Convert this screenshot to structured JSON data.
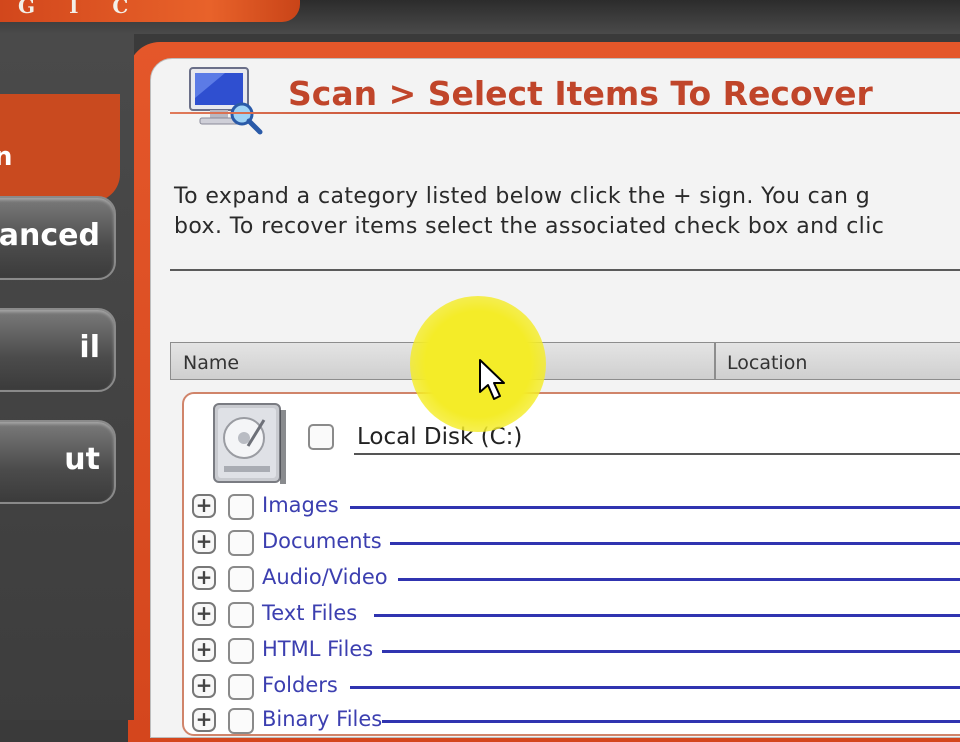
{
  "app": {
    "brand_fragment": "GIC"
  },
  "sidebar": {
    "current_section_fragment": "n",
    "buttons": [
      {
        "label": "anced"
      },
      {
        "label": "il"
      },
      {
        "label": "ut"
      }
    ]
  },
  "page": {
    "title": "Scan > Select Items To Recover",
    "instructions": [
      "To expand a category listed below click the + sign.  You can g",
      "box.  To recover items select the associated check box and clic"
    ]
  },
  "table": {
    "columns": [
      "Name",
      "Location"
    ],
    "drive": {
      "label": "Local Disk (C:)",
      "checked": false
    },
    "categories": [
      {
        "label": "Images",
        "checked": false
      },
      {
        "label": "Documents",
        "checked": false
      },
      {
        "label": "Audio/Video",
        "checked": false
      },
      {
        "label": "Text Files",
        "checked": false
      },
      {
        "label": "HTML Files",
        "checked": false
      },
      {
        "label": "Folders",
        "checked": false
      },
      {
        "label": "Binary Files",
        "checked": false
      }
    ],
    "expand_symbol": "+"
  },
  "colors": {
    "accent_orange": "#e4572a",
    "title_red": "#c0452a",
    "category_blue": "#3c3fb0",
    "cursor_highlight": "#f4ec28"
  },
  "icons": [
    "monitor-magnifier-icon",
    "hard-disk-icon",
    "mouse-pointer-icon"
  ]
}
